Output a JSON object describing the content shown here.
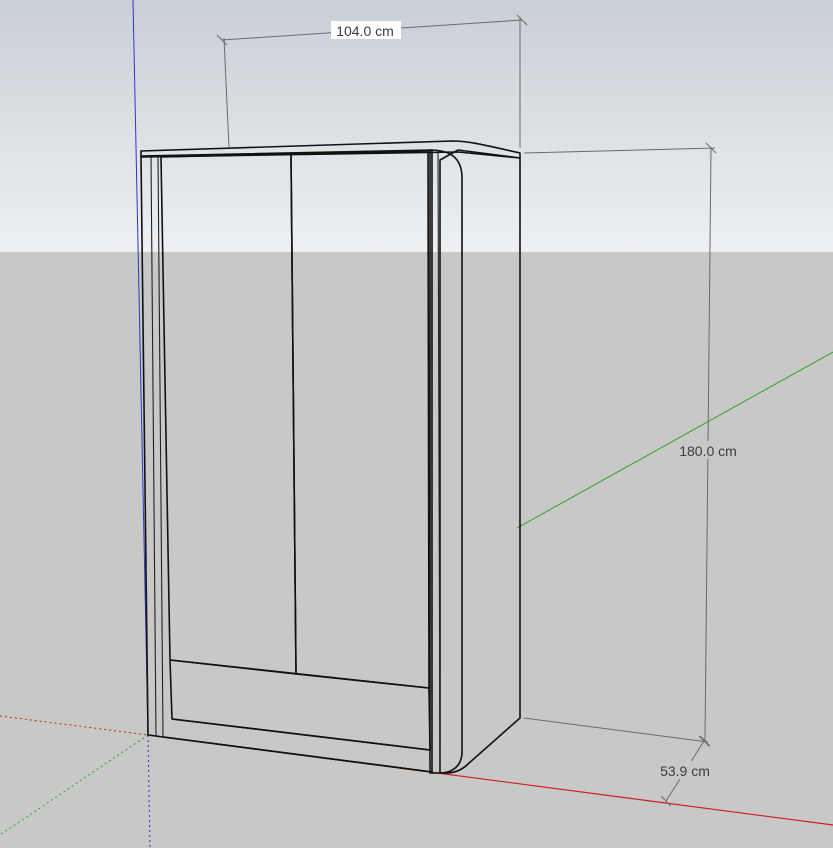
{
  "model": {
    "object": "wardrobe"
  },
  "dimensions": {
    "width_label": "104.0 cm",
    "height_label": "180.0 cm",
    "depth_label": "53.9 cm"
  },
  "colors": {
    "sky_top": "#c9cfd6",
    "sky_bottom": "#eef0f2",
    "ground": "#c8c8c6",
    "front_face": "#fdfdfd",
    "side_face": "#d2d2d2",
    "axis_red": "#cc1f1f",
    "axis_green": "#2aa52a",
    "axis_blue": "#3434cc",
    "dimension_line": "#6a6a6a",
    "edge": "#111111"
  }
}
